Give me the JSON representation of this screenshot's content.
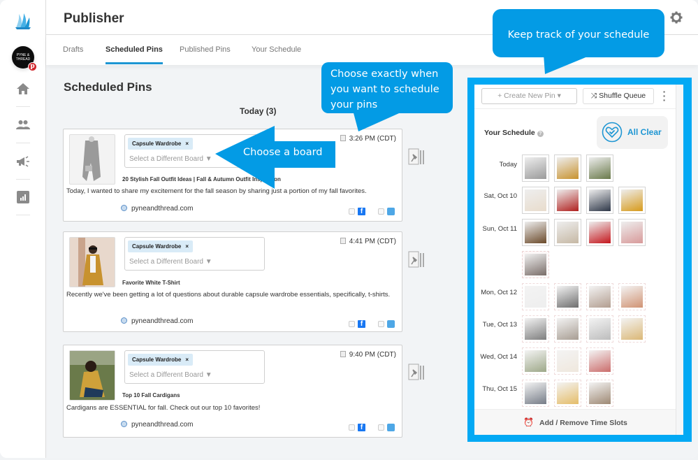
{
  "app": {
    "title": "Publisher",
    "nav": [
      "home",
      "team",
      "campaigns",
      "analytics"
    ],
    "profile_initials": "PYNE & THREAD"
  },
  "tabs": [
    {
      "label": "Drafts",
      "active": false
    },
    {
      "label": "Scheduled Pins",
      "active": true
    },
    {
      "label": "Published Pins",
      "active": false
    },
    {
      "label": "Your Schedule",
      "active": false
    }
  ],
  "main": {
    "section_title": "Scheduled Pins",
    "day_heading": "Today (3)",
    "pins": [
      {
        "board": "Capsule Wardrobe",
        "board_remove": "×",
        "board_select": "Select a Different Board ▼",
        "time": "3:26 PM (CDT)",
        "title": "20 Stylish Fall Outfit Ideas | Fall & Autumn Outfit Inspiration",
        "description": "Today, I wanted to share my excitement for the fall season by sharing just a portion of my fall favorites.",
        "link": "pyneandthread.com",
        "facebook": false,
        "twitter": false
      },
      {
        "board": "Capsule Wardrobe",
        "board_remove": "×",
        "board_select": "Select a Different Board ▼",
        "time": "4:41 PM (CDT)",
        "title": "Favorite White T-Shirt",
        "description": "Recently we've been getting a lot of questions about durable capsule wardrobe essentials, specifically, t-shirts.",
        "link": "pyneandthread.com",
        "facebook": false,
        "twitter": false
      },
      {
        "board": "Capsule Wardrobe",
        "board_remove": "×",
        "board_select": "Select a Different Board ▼",
        "time": "9:40 PM (CDT)",
        "title": "Top 10 Fall Cardigans",
        "description": "Cardigans are ESSENTIAL for fall. Check out our top 10 favorites!",
        "link": "pyneandthread.com",
        "facebook": false,
        "twitter": false
      }
    ]
  },
  "schedule": {
    "create_label": "+ Create New Pin ▾",
    "shuffle_label": "⤨ Shuffle Queue",
    "title": "Your Schedule",
    "help": "?",
    "status": "All Clear",
    "footer": "Add / Remove Time Slots",
    "days": [
      {
        "label": "Today",
        "count": 3
      },
      {
        "label": "Sat, Oct 10",
        "count": 4
      },
      {
        "label": "Sun, Oct 11",
        "count": 5
      },
      {
        "label": "Mon, Oct 12",
        "count": 4
      },
      {
        "label": "Tue, Oct 13",
        "count": 4
      },
      {
        "label": "Wed, Oct 14",
        "count": 3
      },
      {
        "label": "Thu, Oct 15",
        "count": 3
      }
    ]
  },
  "callouts": {
    "when": "Choose exactly when you want to schedule your pins",
    "board": "Choose a board",
    "schedule": "Keep track of your schedule"
  },
  "colors": {
    "accent": "#1e96d3",
    "callout": "#039be5",
    "highlight_frame": "#03a9f4",
    "facebook": "#1877f2",
    "twitter": "#4ea7e6"
  }
}
